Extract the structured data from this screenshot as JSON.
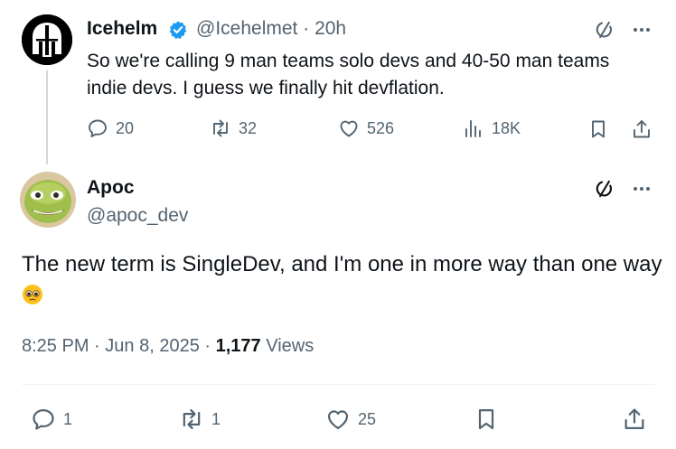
{
  "parent": {
    "name": "Icehelm",
    "handle": "@Icehelmet",
    "time": "20h",
    "text": "So we're calling 9 man teams solo devs and 40-50 man teams indie devs. I guess we finally hit devflation.",
    "stats": {
      "replies": "20",
      "reposts": "32",
      "likes": "526",
      "views": "18K"
    },
    "verified_color": "#1d9bf0"
  },
  "reply": {
    "name": "Apoc",
    "handle": "@apoc_dev",
    "text": "The new term is SingleDev, and I'm one in more way than one way",
    "emoji": "🥹",
    "time": "8:25 PM",
    "date": "Jun 8, 2025",
    "views_count": "1,177",
    "views_label": "Views",
    "stats": {
      "replies": "1",
      "reposts": "1",
      "likes": "25"
    }
  },
  "separator": "·",
  "icons": [
    "grok-icon",
    "more-icon",
    "reply-icon",
    "repost-icon",
    "like-icon",
    "views-icon",
    "bookmark-icon",
    "share-icon",
    "verified-badge-icon"
  ]
}
